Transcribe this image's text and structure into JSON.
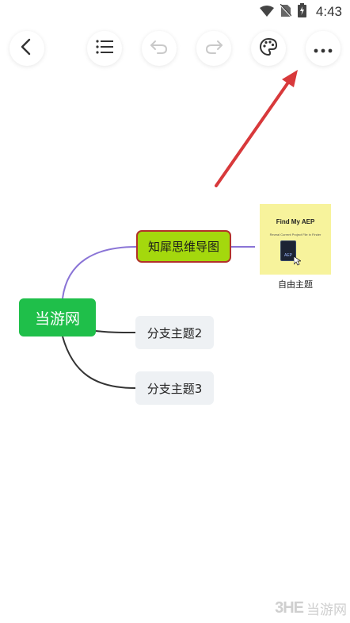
{
  "status_bar": {
    "time": "4:43",
    "icons": [
      "wifi-icon",
      "no-sim-icon",
      "battery-charging-icon"
    ]
  },
  "toolbar": {
    "buttons": [
      {
        "icon": "back-icon"
      },
      {
        "icon": "outline-list-icon"
      },
      {
        "icon": "undo-icon"
      },
      {
        "icon": "redo-icon"
      },
      {
        "icon": "palette-icon"
      },
      {
        "icon": "more-icon"
      }
    ]
  },
  "mindmap": {
    "central_topic": "当游网",
    "main_topic": "知犀思维导图",
    "branches": [
      "分支主题2",
      "分支主题3"
    ],
    "floating_topic": {
      "caption": "自由主题",
      "image_title": "Find My AEP",
      "image_subtitle": "Reveal Current Project File in Finder",
      "file_label": "AEP"
    }
  },
  "colors": {
    "central": "#1fbf4a",
    "main_fill": "#a4d80d",
    "main_border": "#b2322a",
    "branch_fill": "#eef1f4",
    "line_purple": "#8a74d6",
    "line_dark": "#333333",
    "arrow": "#d8393b",
    "float_bg": "#f7f39c"
  },
  "watermark": {
    "logo": "3HE",
    "text": "当游网"
  }
}
